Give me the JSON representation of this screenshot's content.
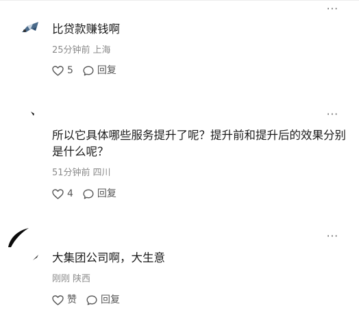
{
  "comments": [
    {
      "text": "比贷款赚钱啊",
      "time": "25分钟前",
      "location": "上海",
      "like_count": "5",
      "reply_label": "回复",
      "more": "···"
    },
    {
      "text": "所以它具体哪些服务提升了呢？提升前和提升后的效果分别是什么呢？",
      "time": "51分钟前",
      "location": "四川",
      "like_count": "4",
      "reply_label": "回复",
      "more": "···"
    },
    {
      "text": "大集团公司啊，大生意",
      "time": "刚刚",
      "location": "陕西",
      "like_count": "赞",
      "reply_label": "回复",
      "more": "···"
    }
  ],
  "icons": {
    "like": "heart-icon",
    "reply": "speech-bubble-icon",
    "more": "ellipsis-icon"
  },
  "colors": {
    "text": "#1a1a1a",
    "meta": "#8a8a8a",
    "action": "#555555"
  }
}
